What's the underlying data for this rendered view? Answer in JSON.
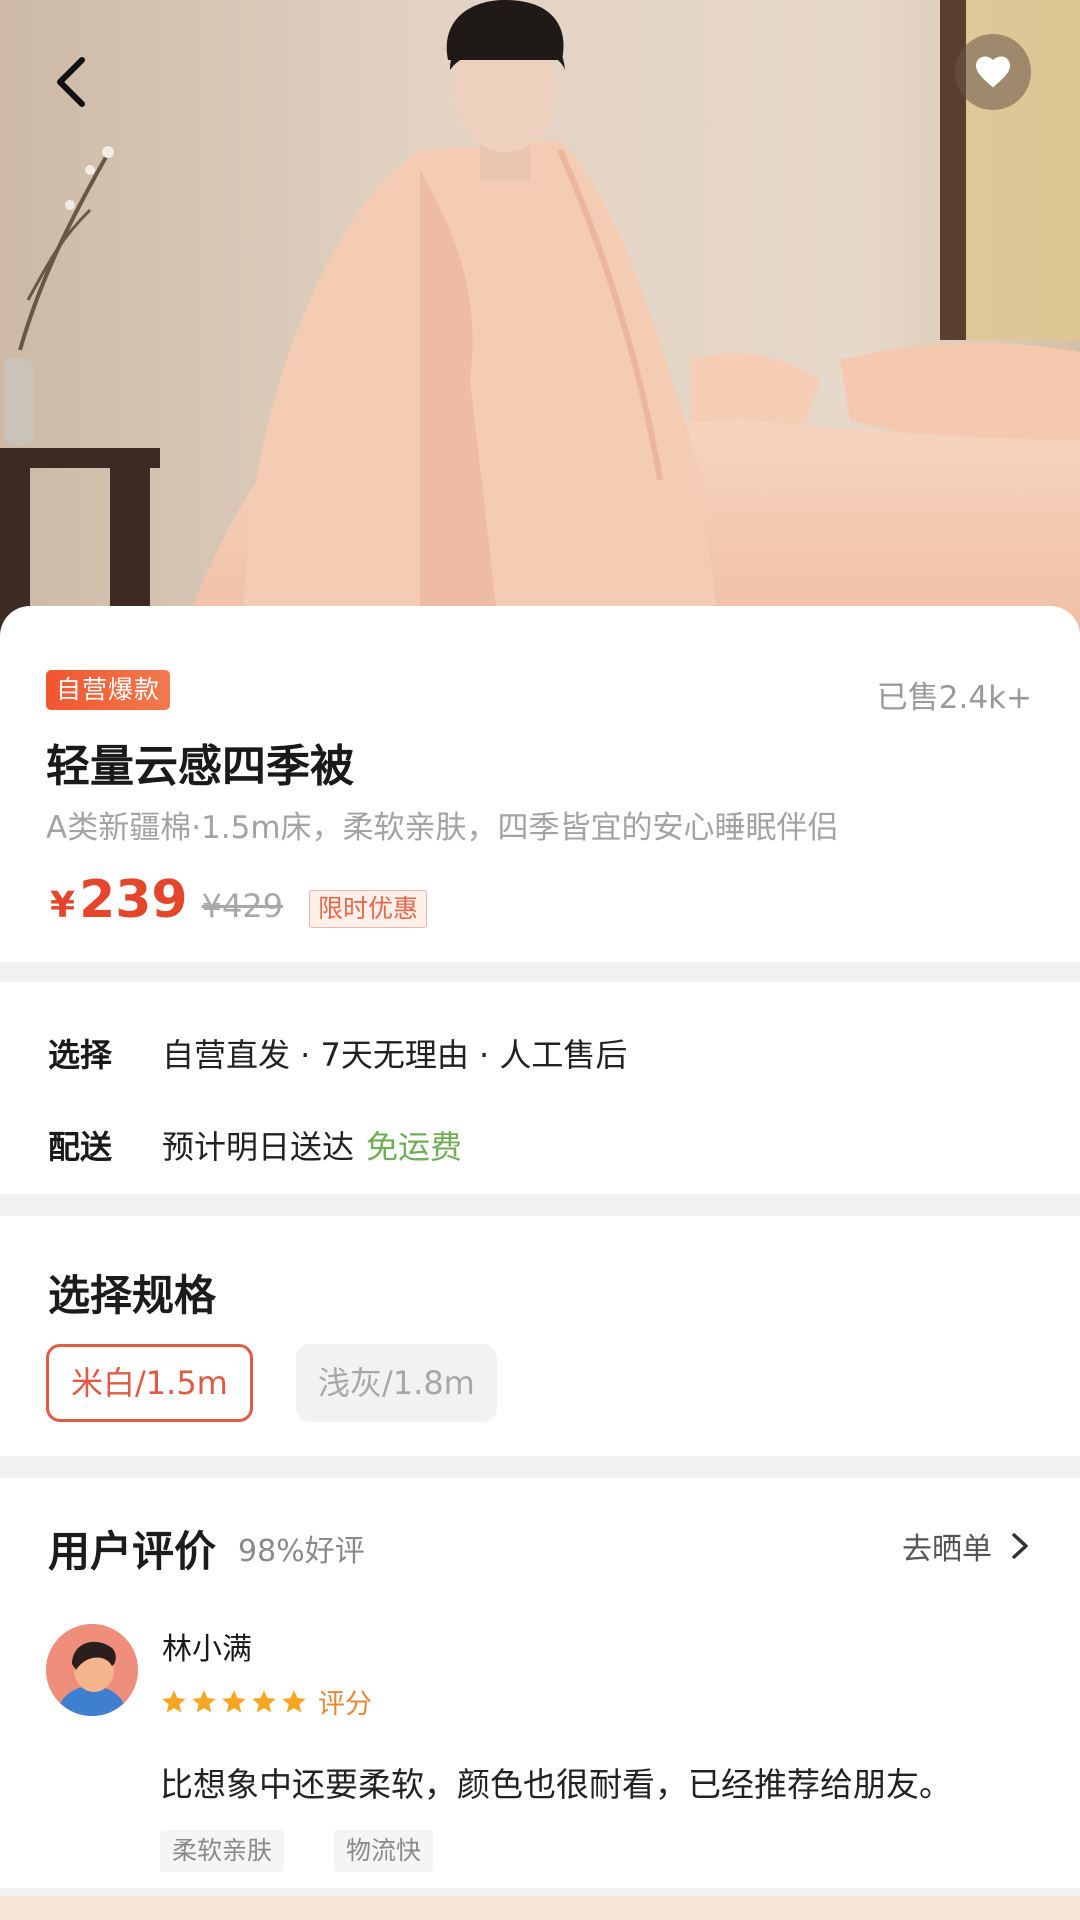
{
  "hero": {
    "image_alt": "model wrapped in peach comforter on bed",
    "back_icon": "chevron-left-icon",
    "favorite_icon": "heart-icon"
  },
  "product": {
    "badge": "自营爆款",
    "sold": "已售2.4k+",
    "title": "轻量云感四季被",
    "subtitle": "A类新疆棉·1.5m床，柔软亲肤，四季皆宜的安心睡眠伴侣",
    "price_symbol": "¥",
    "price": "239",
    "original_price": "¥429",
    "promo": "限时优惠"
  },
  "service": {
    "select_label": "选择",
    "select_value": "自营直发 · 7天无理由 · 人工售后",
    "delivery_label": "配送",
    "delivery_value": "预计明日送达",
    "delivery_free": "免运费"
  },
  "spec": {
    "title": "选择规格",
    "options": [
      {
        "label": "米白/1.5m",
        "selected": true
      },
      {
        "label": "浅灰/1.8m",
        "selected": false
      }
    ]
  },
  "reviews": {
    "title": "用户评价",
    "rate": "98%好评",
    "more_label": "去晒单",
    "items": [
      {
        "user": "林小满",
        "stars": 5,
        "score_label": "评分",
        "text": "比想象中还要柔软，颜色也很耐看，已经推荐给朋友。",
        "tags": [
          "柔软亲肤",
          "物流快"
        ]
      }
    ]
  },
  "colors": {
    "accent": "#e4462b",
    "badge": "#f2552f",
    "free_shipping": "#6fae56",
    "star": "#f5a623"
  }
}
